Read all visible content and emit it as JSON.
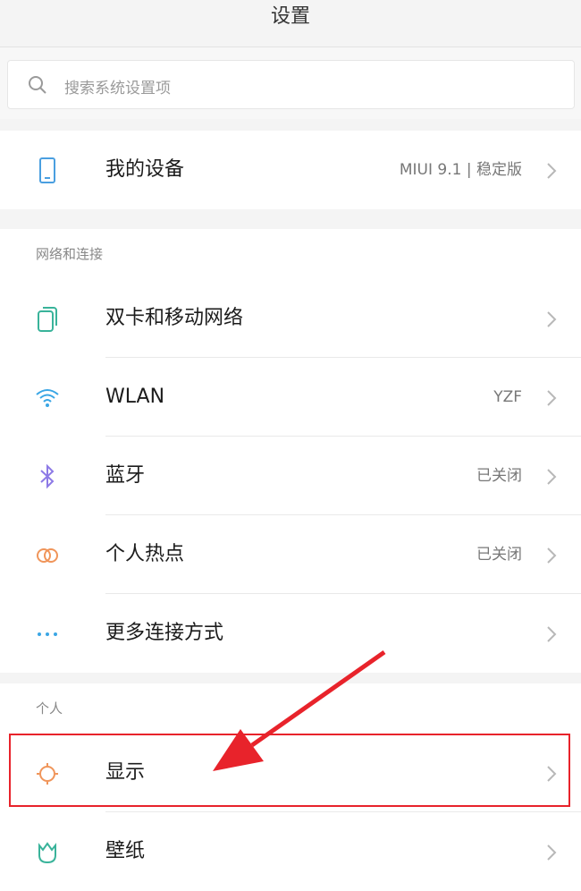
{
  "title": "设置",
  "search": {
    "placeholder": "搜索系统设置项"
  },
  "device": {
    "label": "我的设备",
    "value": "MIUI 9.1 | 稳定版"
  },
  "network": {
    "title": "网络和连接",
    "items": [
      {
        "label": "双卡和移动网络",
        "value": ""
      },
      {
        "label": "WLAN",
        "value": "YZF"
      },
      {
        "label": "蓝牙",
        "value": "已关闭"
      },
      {
        "label": "个人热点",
        "value": "已关闭"
      },
      {
        "label": "更多连接方式",
        "value": ""
      }
    ]
  },
  "personal": {
    "title": "个人",
    "items": [
      {
        "label": "显示",
        "value": ""
      },
      {
        "label": "壁纸",
        "value": ""
      }
    ]
  },
  "colors": {
    "device_icon": "#4a9fe0",
    "sim_icon": "#39b39a",
    "wifi_icon": "#3aa6e5",
    "bluetooth_icon": "#8d7ae6",
    "hotspot_icon": "#f0955a",
    "more_icon": "#3aa6e5",
    "display_icon": "#f0955a",
    "wallpaper_icon": "#39b39a",
    "annotation": "#e8232b"
  }
}
